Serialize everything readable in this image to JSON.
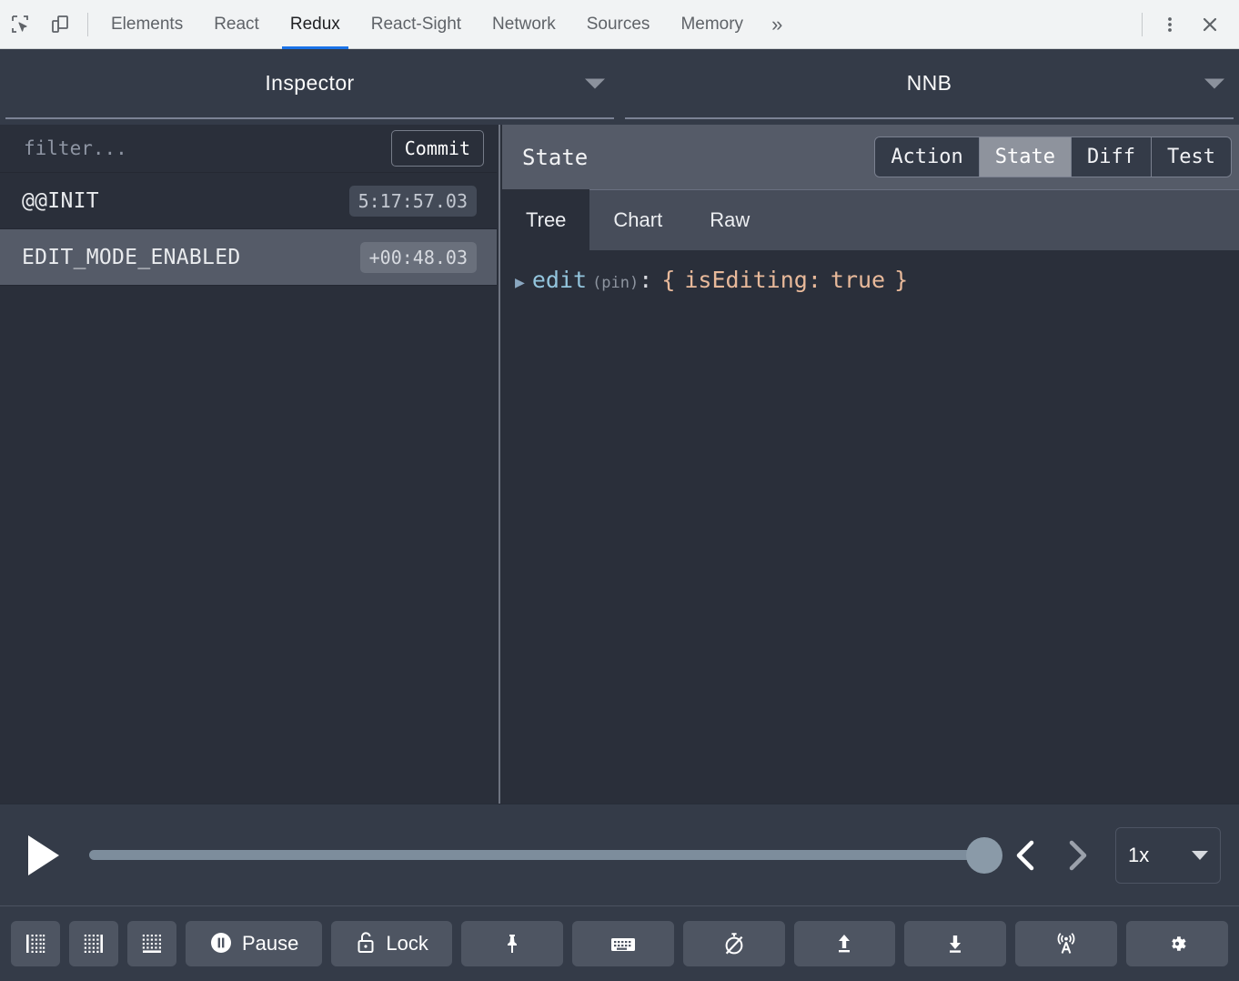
{
  "devtools": {
    "icons": [
      {
        "name": "inspect-element-icon",
        "label": "Inspect element"
      },
      {
        "name": "device-toolbar-icon",
        "label": "Toggle device toolbar"
      }
    ],
    "tabs": [
      {
        "label": "Elements",
        "active": false
      },
      {
        "label": "React",
        "active": false
      },
      {
        "label": "Redux",
        "active": true
      },
      {
        "label": "React-Sight",
        "active": false
      },
      {
        "label": "Network",
        "active": false
      },
      {
        "label": "Sources",
        "active": false
      },
      {
        "label": "Memory",
        "active": false
      }
    ],
    "overflow_label": "»",
    "more_options_label": "⋮",
    "close_label": "✕",
    "accent_color": "#1a73e8",
    "bar_background": "#f1f3f4"
  },
  "monitor_header": {
    "left_select": {
      "value": "Inspector"
    },
    "right_select": {
      "value": "NNB"
    }
  },
  "actions_pane": {
    "filter_placeholder": "filter...",
    "filter_value": "",
    "commit_label": "Commit",
    "items": [
      {
        "name": "@@INIT",
        "time": "5:17:57.03",
        "selected": false
      },
      {
        "name": "EDIT_MODE_ENABLED",
        "time": "+00:48.03",
        "selected": true
      }
    ]
  },
  "state_pane": {
    "title": "State",
    "segments": [
      {
        "label": "Action",
        "active": false
      },
      {
        "label": "State",
        "active": true
      },
      {
        "label": "Diff",
        "active": false
      },
      {
        "label": "Test",
        "active": false
      }
    ],
    "subtabs": [
      {
        "label": "Tree",
        "active": true
      },
      {
        "label": "Chart",
        "active": false
      },
      {
        "label": "Raw",
        "active": false
      }
    ],
    "tree": {
      "arrow": "▶",
      "key": "edit",
      "annotation": "(pin)",
      "colon": ":",
      "open_brace": "{",
      "value_key": "isEditing:",
      "value": "true",
      "close_brace": "}"
    }
  },
  "player": {
    "play_label": "▶",
    "slider_percent": 100,
    "prev_label": "‹",
    "next_label": "›",
    "speed_value": "1x"
  },
  "bottom_toolbar": {
    "buttons": [
      {
        "name": "dock-left-button",
        "icon": "dock-left-icon",
        "label": ""
      },
      {
        "name": "dock-right-button",
        "icon": "dock-right-icon",
        "label": ""
      },
      {
        "name": "dock-bottom-button",
        "icon": "dock-bottom-icon",
        "label": ""
      },
      {
        "name": "pause-button",
        "icon": "pause-icon",
        "label": "Pause"
      },
      {
        "name": "lock-button",
        "icon": "unlock-icon",
        "label": "Lock"
      },
      {
        "name": "pin-button",
        "icon": "pin-icon",
        "label": ""
      },
      {
        "name": "keyboard-button",
        "icon": "keyboard-icon",
        "label": ""
      },
      {
        "name": "dispatch-timer-off-button",
        "icon": "stopwatch-off-icon",
        "label": ""
      },
      {
        "name": "import-button",
        "icon": "upload-icon",
        "label": ""
      },
      {
        "name": "export-button",
        "icon": "download-icon",
        "label": ""
      },
      {
        "name": "remote-button",
        "icon": "broadcast-icon",
        "label": ""
      },
      {
        "name": "settings-button",
        "icon": "gear-icon",
        "label": ""
      }
    ]
  }
}
